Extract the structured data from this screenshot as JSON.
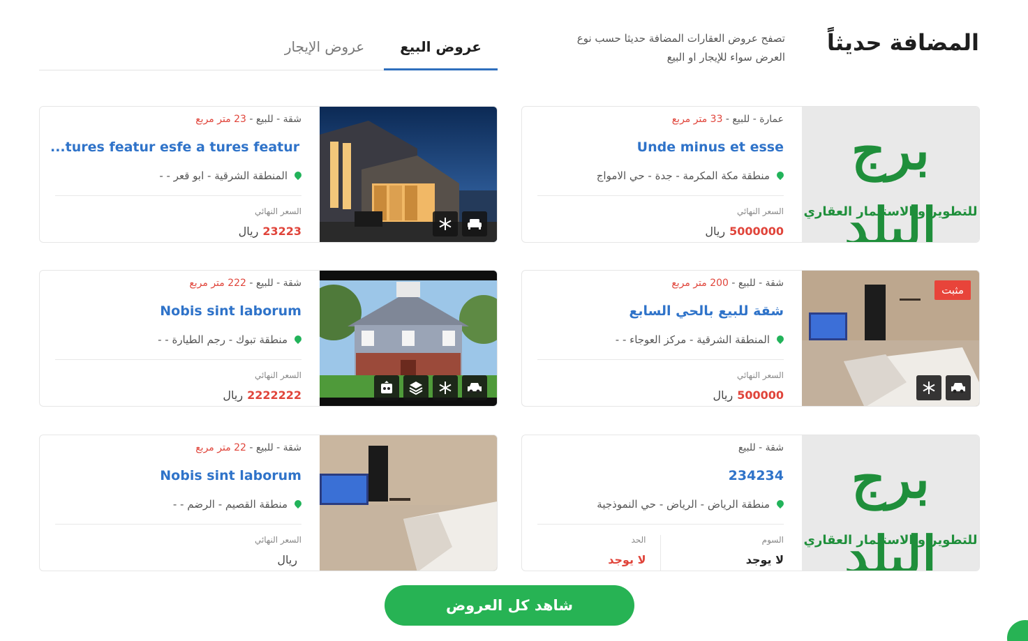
{
  "header": {
    "title": "المضافة حديثاً",
    "subtitle": "تصفح عروض العقارات المضافة حديثا حسب نوع العرض سواء للإيجار او البيع"
  },
  "tabs": [
    {
      "label": "عروض البيع",
      "active": true
    },
    {
      "label": "عروض الإيجار",
      "active": false
    }
  ],
  "listings": [
    {
      "meta": "عمارة - للبيع - ",
      "area": "33 متر مربع",
      "title": "Unde minus et esse",
      "location": "منطقة مكة المكرمة - جدة - حي الامواج",
      "price_label": "السعر النهائي",
      "price": "5000000",
      "currency": "ريال",
      "image": "logo",
      "amenities": []
    },
    {
      "meta": "شقة - للبيع - ",
      "area": "23 متر مربع",
      "title": "...tures featur esfe a tures featur es",
      "location": "المنطقة الشرقية - ابو قعر - -",
      "price_label": "السعر النهائي",
      "price": "23223",
      "currency": "ريال",
      "image": "house-night",
      "amenities": [
        "sofa-icon",
        "ac-icon"
      ]
    },
    {
      "meta": "شقة - للبيع - ",
      "area": "200 متر مربع",
      "title": "شقة للبيع بالحي السابع",
      "location": "المنطقة الشرقية - مركز العوجاء - -",
      "price_label": "السعر النهائي",
      "price": "500000",
      "currency": "ريال",
      "image": "bedroom",
      "badge": "مثبت",
      "amenities": [
        "car-icon",
        "ac-icon"
      ]
    },
    {
      "meta": "شقة - للبيع - ",
      "area": "222 متر مربع",
      "title": "Nobis sint laborum",
      "location": "منطقة تبوك - رجم الطيارة - -",
      "price_label": "السعر النهائي",
      "price": "2222222",
      "currency": "ريال",
      "image": "house-day",
      "amenities": [
        "car-icon",
        "ac-icon",
        "layers-icon",
        "elevator-icon"
      ]
    },
    {
      "meta": "شقة - للبيع",
      "area": "",
      "title": "234234",
      "location": "منطقة الرياض - الرياض - حي النموذجية",
      "features": [
        {
          "label": "السوم",
          "value": "لا يوجد"
        },
        {
          "label": "الحد",
          "value": "لا يوجد"
        }
      ],
      "image": "logo",
      "amenities": []
    },
    {
      "meta": "شقة - للبيع - ",
      "area": "22 متر مربع",
      "title": "Nobis sint laborum",
      "location": "منطقة القصيم - الرضم - -",
      "price_label": "السعر النهائي",
      "price": "",
      "currency": "ريال",
      "image": "bedroom2",
      "amenities": []
    }
  ],
  "logo": {
    "line1": "برج البلد",
    "line2": "للتطوير و الاستثمار العقاري"
  },
  "cta": {
    "label": "شاهد كل العروض"
  },
  "colors": {
    "accent": "#27b354",
    "link": "#2f73c9",
    "price": "#e0443a",
    "tab_underline": "#2f6fbd"
  }
}
